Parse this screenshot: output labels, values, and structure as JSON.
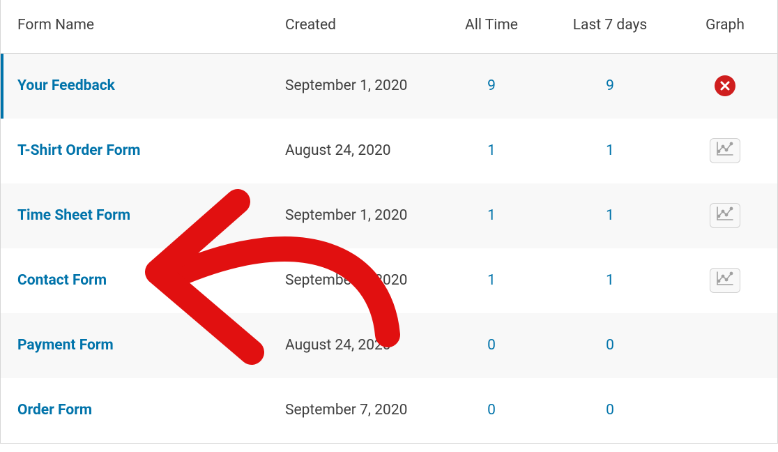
{
  "columns": {
    "name": "Form Name",
    "created": "Created",
    "all_time": "All Time",
    "last7": "Last 7 days",
    "graph": "Graph"
  },
  "rows": [
    {
      "name": "Your Feedback",
      "created": "September 1, 2020",
      "all_time": "9",
      "last7": "9",
      "graph": "delete",
      "active": true
    },
    {
      "name": "T-Shirt Order Form",
      "created": "August 24, 2020",
      "all_time": "1",
      "last7": "1",
      "graph": "chart",
      "active": false
    },
    {
      "name": "Time Sheet Form",
      "created": "September 1, 2020",
      "all_time": "1",
      "last7": "1",
      "graph": "chart",
      "active": false
    },
    {
      "name": "Contact Form",
      "created": "September 7, 2020",
      "all_time": "1",
      "last7": "1",
      "graph": "chart",
      "active": false
    },
    {
      "name": "Payment Form",
      "created": "August 24, 2020",
      "all_time": "0",
      "last7": "0",
      "graph": "none",
      "active": false
    },
    {
      "name": "Order Form",
      "created": "September 7, 2020",
      "all_time": "0",
      "last7": "0",
      "graph": "none",
      "active": false
    }
  ],
  "colors": {
    "link": "#0073aa",
    "delete": "#cf1e1e",
    "annotation": "#e11010"
  }
}
